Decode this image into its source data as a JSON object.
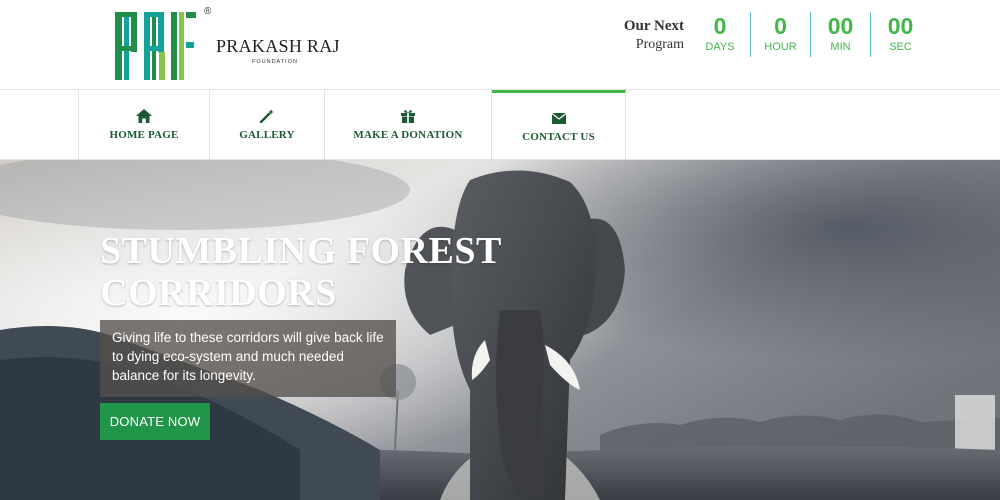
{
  "header": {
    "logo_text": "PRF",
    "registered_mark": "®",
    "org_name": "PRAKASH RAJ",
    "org_subtitle": "FOUNDATION",
    "next_program_line1": "Our Next",
    "next_program_line2": "Program",
    "countdown": [
      {
        "value": "0",
        "label": "DAYS"
      },
      {
        "value": "0",
        "label": "HOUR"
      },
      {
        "value": "00",
        "label": "MIN"
      },
      {
        "value": "00",
        "label": "SEC"
      }
    ]
  },
  "nav": {
    "items": [
      {
        "label": "HOME PAGE",
        "icon": "home-icon",
        "active": false
      },
      {
        "label": "GALLERY",
        "icon": "magic-wand-icon",
        "active": false
      },
      {
        "label": "MAKE A DONATION",
        "icon": "gift-icon",
        "active": false
      },
      {
        "label": "CONTACT US",
        "icon": "envelope-icon",
        "active": true
      }
    ]
  },
  "hero": {
    "title_line1": "STUMBLING FOREST",
    "title_line2": "CORRIDORS",
    "description": "Giving life to these corridors will give back life to dying eco-system and much needed balance for its longevity.",
    "donate_label": "DONATE NOW"
  },
  "colors": {
    "accent_green": "#43b649",
    "nav_text": "#1c5a33",
    "button_green": "#21964a",
    "logo_teal": "#14a39a",
    "logo_green": "#1f8f49"
  }
}
